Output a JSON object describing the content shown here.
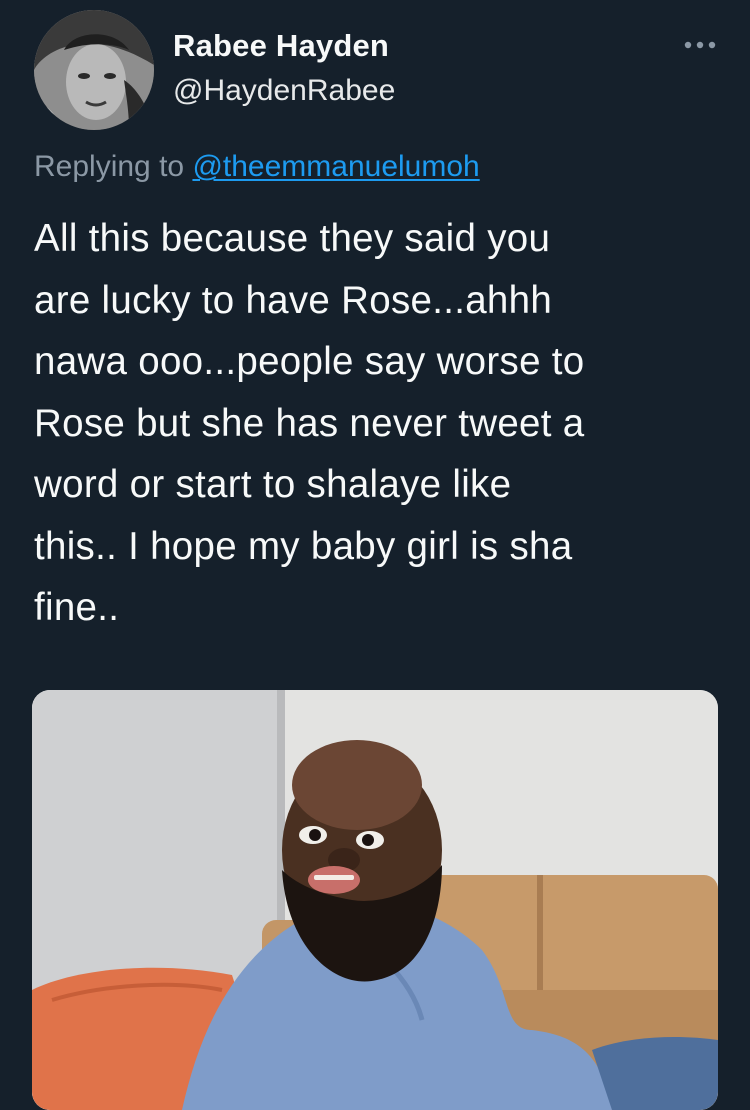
{
  "tweet": {
    "author": {
      "display_name": "Rabee Hayden",
      "handle": "@HaydenRabee",
      "avatar_icon": "profile-photo"
    },
    "more_icon": "more-horizontal-icon",
    "reply": {
      "prefix": "Replying to ",
      "mention": "@theemmanuelumoh"
    },
    "text": "All this because they said you\nare lucky to have Rose...ahhh\nnawa ooo...people say worse to\nRose but she has never tweet a\nword or start to shalaye like\nthis.. I hope my baby girl is sha\nfine..",
    "media": {
      "kind": "image",
      "colors": {
        "wall": "#dcdcda",
        "sofa": "#c79a6a",
        "pillow": "#e0734a",
        "shirt": "#7f9cc9"
      }
    }
  },
  "theme": {
    "background": "#15202b",
    "text": "#f7f9f9",
    "secondary": "#8b98a5",
    "link": "#1d9bf0"
  }
}
